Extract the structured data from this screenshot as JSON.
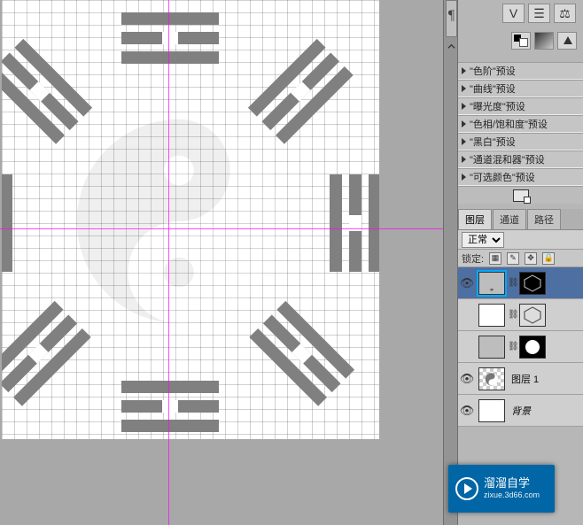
{
  "top_tools_row1": [
    {
      "id": "v-tool",
      "glyph": "V"
    },
    {
      "id": "levels-tool",
      "glyph": "☰"
    },
    {
      "id": "balance-tool",
      "glyph": "⚖"
    }
  ],
  "adjust_icons": [
    {
      "id": "foreground-background-icon"
    },
    {
      "id": "gradient-icon"
    },
    {
      "id": "posterize-icon"
    }
  ],
  "presets": [
    {
      "label": "\"色阶\"预设"
    },
    {
      "label": "\"曲线\"预设"
    },
    {
      "label": "\"曝光度\"预设"
    },
    {
      "label": "\"色相/饱和度\"预设"
    },
    {
      "label": "\"黑白\"预设"
    },
    {
      "label": "\"通道混和器\"预设"
    },
    {
      "label": "\"可选颜色\"预设"
    }
  ],
  "panel_tabs": [
    {
      "id": "layers",
      "label": "图层",
      "active": true
    },
    {
      "id": "channels",
      "label": "通道",
      "active": false
    },
    {
      "id": "paths",
      "label": "路径",
      "active": false
    }
  ],
  "blend_mode": "正常",
  "lock_label": "锁定:",
  "layers": [
    {
      "name": "",
      "masked": true,
      "selected": true,
      "visible": true,
      "mask": "bagua-dark",
      "thumb": "gray"
    },
    {
      "name": "",
      "masked": true,
      "selected": false,
      "visible": false,
      "mask": "bagua-light",
      "thumb": "white"
    },
    {
      "name": "",
      "masked": true,
      "selected": false,
      "visible": false,
      "mask": "circle",
      "thumb": "gray"
    },
    {
      "name": "图层 1",
      "masked": false,
      "selected": false,
      "visible": true,
      "mask": "",
      "thumb": "yinyang"
    },
    {
      "name": "背景",
      "masked": false,
      "selected": false,
      "visible": true,
      "mask": "",
      "thumb": "white",
      "italic": true
    }
  ],
  "pilcrow": "¶",
  "watermark": {
    "brand": "溜溜自学",
    "url": "zixue.3d66.com"
  }
}
